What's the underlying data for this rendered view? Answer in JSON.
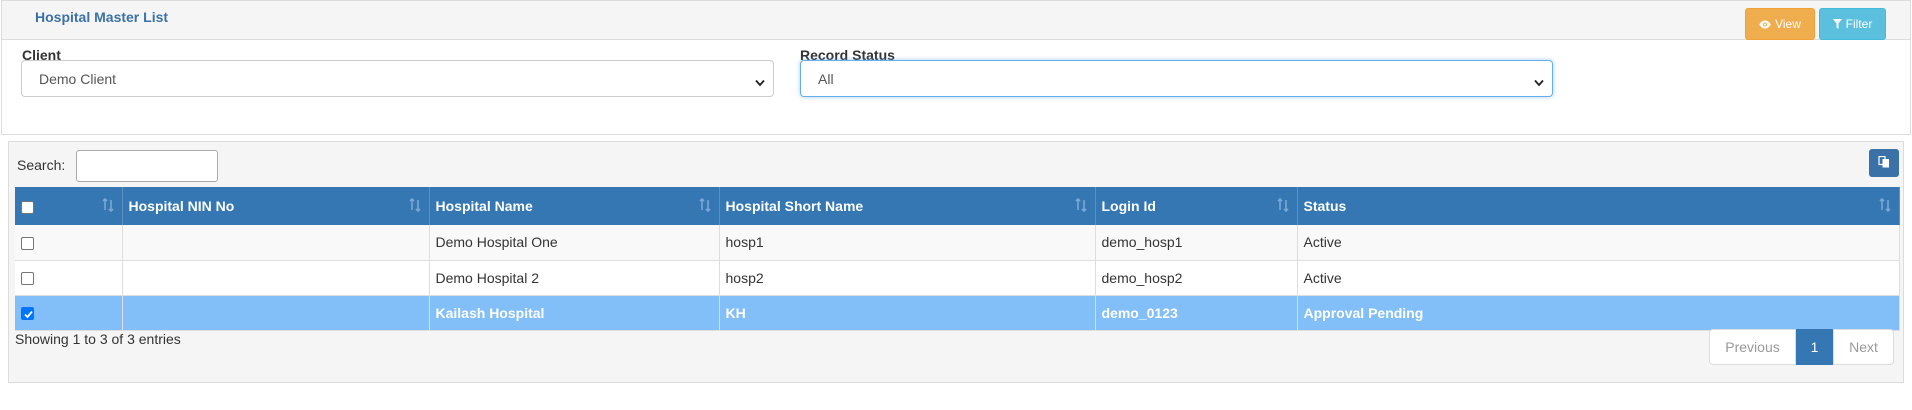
{
  "header": {
    "title": "Hospital Master List",
    "view_label": "View",
    "filter_label": "Filter"
  },
  "filters": {
    "client_label": "Client",
    "client_value": "Demo Client",
    "status_label": "Record Status",
    "status_value": "All"
  },
  "table": {
    "search_label": "Search:",
    "search_value": "",
    "columns": [
      "",
      "Hospital NIN No",
      "Hospital Name",
      "Hospital Short Name",
      "Login Id",
      "Status"
    ],
    "rows": [
      {
        "checked": false,
        "nin": "",
        "name": "Demo Hospital One",
        "short": "hosp1",
        "login": "demo_hosp1",
        "status": "Active"
      },
      {
        "checked": false,
        "nin": "",
        "name": "Demo Hospital 2",
        "short": "hosp2",
        "login": "demo_hosp2",
        "status": "Active"
      },
      {
        "checked": true,
        "nin": "",
        "name": "Kailash Hospital",
        "short": "KH",
        "login": "demo_0123",
        "status": "Approval Pending"
      }
    ],
    "info": "Showing 1 to 3 of 3 entries"
  },
  "pagination": {
    "previous": "Previous",
    "current": "1",
    "next": "Next"
  },
  "icons": {
    "view": "eye-icon",
    "filter": "funnel-icon",
    "copy": "copy-icon",
    "sort": "sort-icon",
    "dropdown": "chevron-down-icon"
  },
  "colors": {
    "header_blue": "#3477b3",
    "selected_row": "#82bef7",
    "view_button": "#f0ad4e",
    "filter_button": "#5bc0de",
    "title_text": "#3a72a8"
  }
}
